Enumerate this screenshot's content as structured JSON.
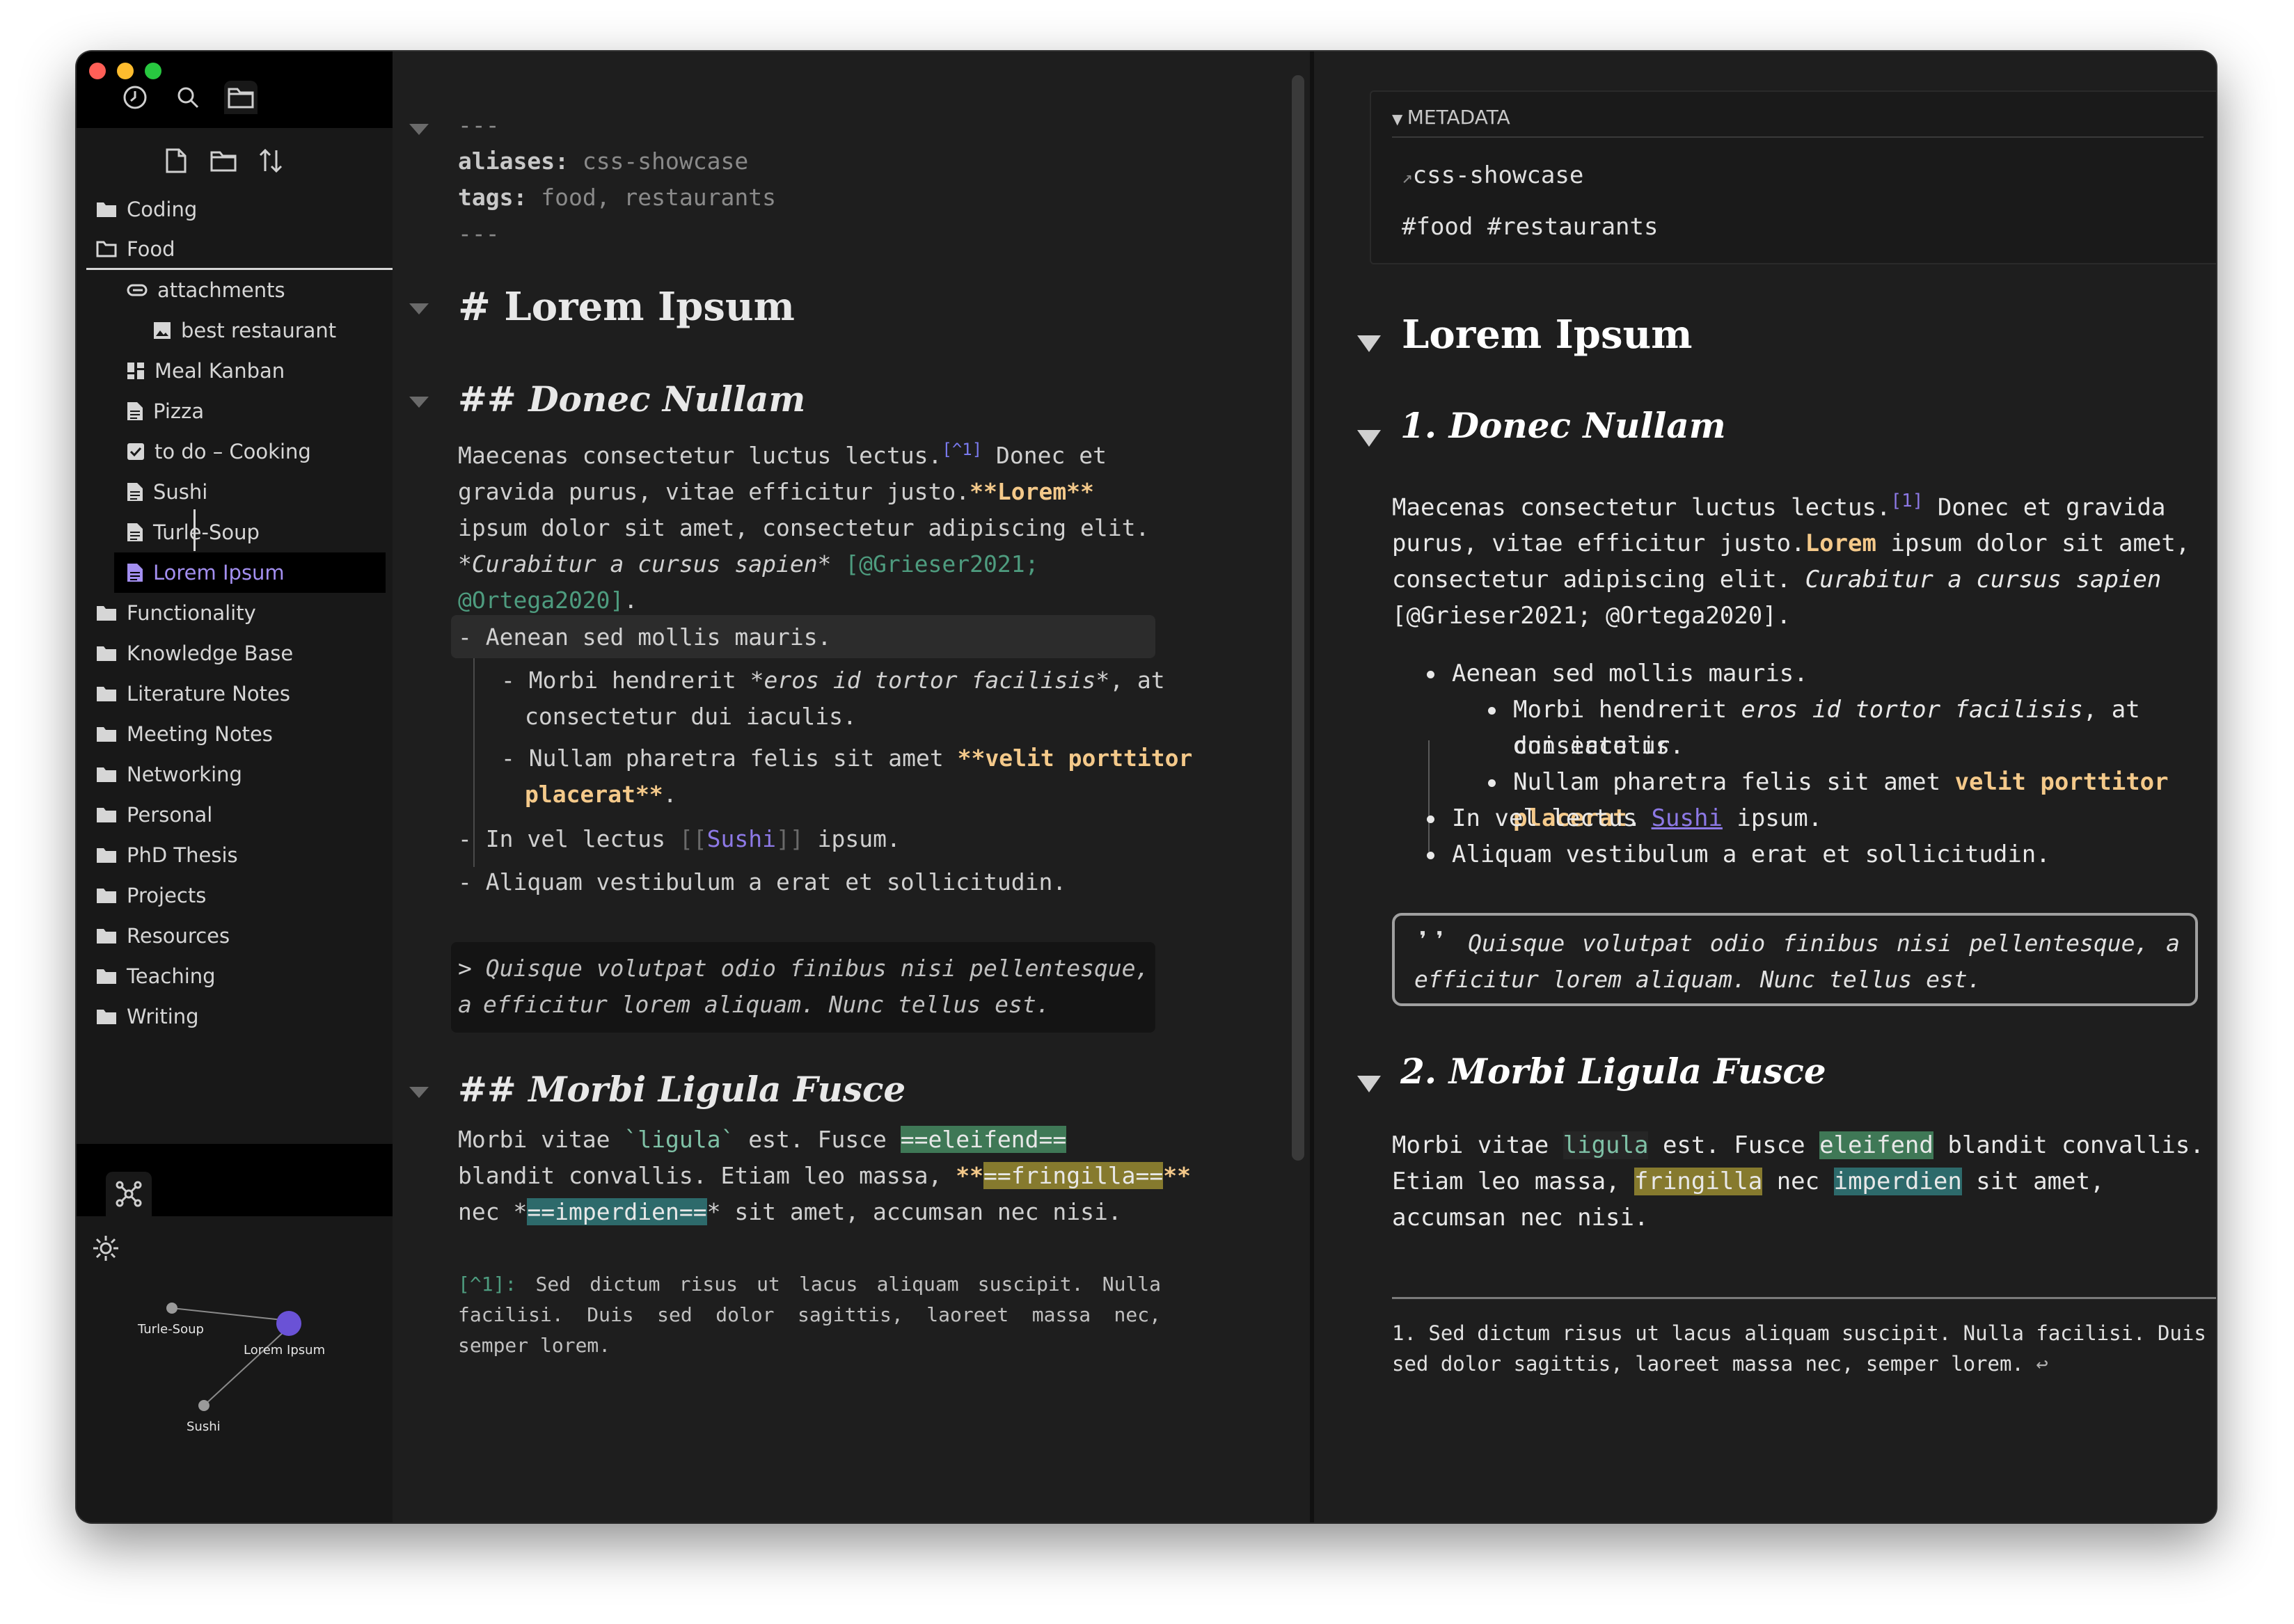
{
  "sidebar": {
    "tree": [
      {
        "label": "Coding"
      },
      {
        "label": "Food"
      },
      {
        "label": "attachments"
      },
      {
        "label": "best restaurant"
      },
      {
        "label": "Meal Kanban"
      },
      {
        "label": "Pizza"
      },
      {
        "label": "to do – Cooking"
      },
      {
        "label": "Sushi"
      },
      {
        "label": "Turle-Soup"
      },
      {
        "label": "Lorem Ipsum"
      },
      {
        "label": "Functionality"
      },
      {
        "label": "Knowledge Base"
      },
      {
        "label": "Literature Notes"
      },
      {
        "label": "Meeting Notes"
      },
      {
        "label": "Networking"
      },
      {
        "label": "Personal"
      },
      {
        "label": "PhD Thesis"
      },
      {
        "label": "Projects"
      },
      {
        "label": "Resources"
      },
      {
        "label": "Teaching"
      },
      {
        "label": "Writing"
      }
    ],
    "graph": {
      "nodes": [
        "Turle-Soup",
        "Lorem Ipsum",
        "Sushi"
      ]
    }
  },
  "editor": {
    "frontmatter": {
      "dashes": "---",
      "aliases_key": "aliases:",
      "aliases_val": " css-showcase",
      "tags_key": "tags:",
      "tags_val": " food, restaurants"
    },
    "h1": "# Lorem Ipsum",
    "h2a": "## Donec Nullam",
    "p1": {
      "a": "Maecenas consectetur luctus lectus.",
      "fn": "[^1]",
      "b": " Donec et gravida purus, vitae efficitur justo.",
      "bold": "**Lorem**",
      "c": " ipsum dolor sit amet, consectetur adipiscing elit.",
      "italic": "*Curabitur a cursus sapien*",
      "cite": " [@Grieser2021; @Ortega2020]",
      "end": "."
    },
    "list": {
      "item1": "- Aenean sed mollis mauris.",
      "sub1_a": "- Morbi hendrerit ",
      "sub1_it": "*eros id tortor facilisis*",
      "sub1_b": ", at",
      "sub1_c": "consectetur dui iaculis.",
      "sub2_a": "- Nullam pharetra felis sit amet ",
      "sub2_b": "**velit porttitor",
      "sub2_c": "placerat**",
      "sub2_d": ".",
      "item2_a": "- In vel lectus ",
      "item2_open": "[[",
      "item2_link": "Sushi",
      "item2_close": "]]",
      "item2_b": " ipsum.",
      "item3": "- Aliquam vestibulum a erat et sollicitudin."
    },
    "quote": {
      "marker": "> ",
      "line1": "Quisque volutpat odio finibus nisi pellentesque, a",
      "line2": "efficitur lorem aliquam. Nunc tellus est."
    },
    "h2b": "## Morbi Ligula Fusce",
    "p2": {
      "a": "Morbi vitae ",
      "code": "`ligula`",
      "b": " est. Fusce ",
      "hl1": "==eleifend==",
      "c": "blandit convallis. Etiam leo massa, ",
      "bold_open": "**",
      "hl2": "==fringilla==",
      "bold_close": "**",
      "d": "nec ",
      "it_open": "*",
      "hl3": "==imperdien==",
      "it_close": "*",
      "e": " sit amet, accumsan nec nisi."
    },
    "footnote": {
      "label": "[^1]:",
      "text": " Sed dictum risus ut lacus aliquam suscipit. Nulla facilisi. Duis sed dolor sagittis, laoreet massa nec, semper lorem."
    }
  },
  "reader": {
    "metadata": {
      "title": "METADATA",
      "alias": "css-showcase",
      "tags": "#food #restaurants"
    },
    "h1": "Lorem Ipsum",
    "h2a": "1. Donec Nullam",
    "p1": {
      "a": "Maecenas consectetur luctus lectus.",
      "fn": "[1]",
      "b": " Donec et gravida purus, vitae efficitur justo.",
      "bold": "Lorem",
      "c": " ipsum dolor sit amet, consectetur adipiscing elit. ",
      "italic": "Curabitur a cursus sapien",
      "cite": " [@Grieser2021; @Ortega2020]."
    },
    "list": {
      "item1": "Aenean sed mollis mauris.",
      "sub1_a": "Morbi hendrerit ",
      "sub1_it": "eros id tortor facilisis",
      "sub1_b": ", at consectetur",
      "sub1_c": "dui iaculis.",
      "sub2_a": "Nullam pharetra felis sit amet ",
      "sub2_b": "velit porttitor placerat",
      "sub2_c": ".",
      "item2_a": "In vel lectus ",
      "item2_link": "Sushi",
      "item2_b": " ipsum.",
      "item3": "Aliquam vestibulum a erat et sollicitudin."
    },
    "quote": "Quisque volutpat odio finibus nisi pellentesque, a efficitur lorem aliquam. Nunc tellus est.",
    "h2b": "2. Morbi Ligula Fusce",
    "p2": {
      "a": "Morbi vitae ",
      "code": "ligula",
      "b": " est. Fusce ",
      "hl1": "eleifend",
      "c": " blandit convallis. Etiam leo massa, ",
      "hl2": "fringilla",
      "d": " nec ",
      "hl3": "imperdien",
      "e": " sit amet, accumsan nec nisi."
    },
    "footnote": {
      "num": "1.",
      "text": "Sed dictum risus ut lacus aliquam suscipit. Nulla facilisi. Duis sed dolor sagittis, laoreet massa nec, semper lorem.",
      "backref": "↩"
    }
  }
}
